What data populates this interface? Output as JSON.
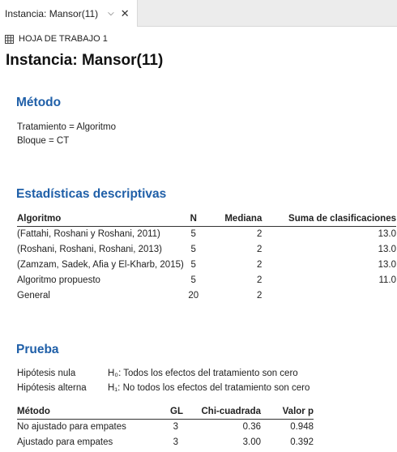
{
  "tab": {
    "label": "Instancia: Mansor(11)",
    "dropdown_icon": "chevron-down-icon",
    "close_icon": "close-icon"
  },
  "worksheet": {
    "label": "HOJA DE TRABAJO 1",
    "icon": "grid-icon"
  },
  "title": "Instancia: Mansor(11)",
  "method": {
    "heading": "Método",
    "treatment": "Tratamiento = Algoritmo",
    "block": "Bloque = CT"
  },
  "descriptive": {
    "heading": "Estadísticas descriptivas",
    "headers": [
      "Algoritmo",
      "N",
      "Mediana",
      "Suma de clasificaciones"
    ],
    "rows": [
      [
        "(Fattahi, Roshani y Roshani, 2011)",
        "5",
        "2",
        "13.0"
      ],
      [
        "(Roshani, Roshani, Roshani, 2013)",
        "5",
        "2",
        "13.0"
      ],
      [
        "(Zamzam, Sadek, Afia y El-Kharb, 2015)",
        "5",
        "2",
        "13.0"
      ],
      [
        "Algoritmo propuesto",
        "5",
        "2",
        "11.0"
      ],
      [
        "General",
        "20",
        "2",
        ""
      ]
    ]
  },
  "test": {
    "heading": "Prueba",
    "null_label": "Hipótesis nula",
    "null_text": "H₀: Todos los efectos del tratamiento son cero",
    "alt_label": "Hipótesis alterna",
    "alt_text": "H₁: No todos los efectos del tratamiento son cero",
    "headers": [
      "Método",
      "GL",
      "Chi-cuadrada",
      "Valor p"
    ],
    "rows": [
      [
        "No ajustado para empates",
        "3",
        "0.36",
        "0.948"
      ],
      [
        "Ajustado para empates",
        "3",
        "3.00",
        "0.392"
      ]
    ]
  }
}
